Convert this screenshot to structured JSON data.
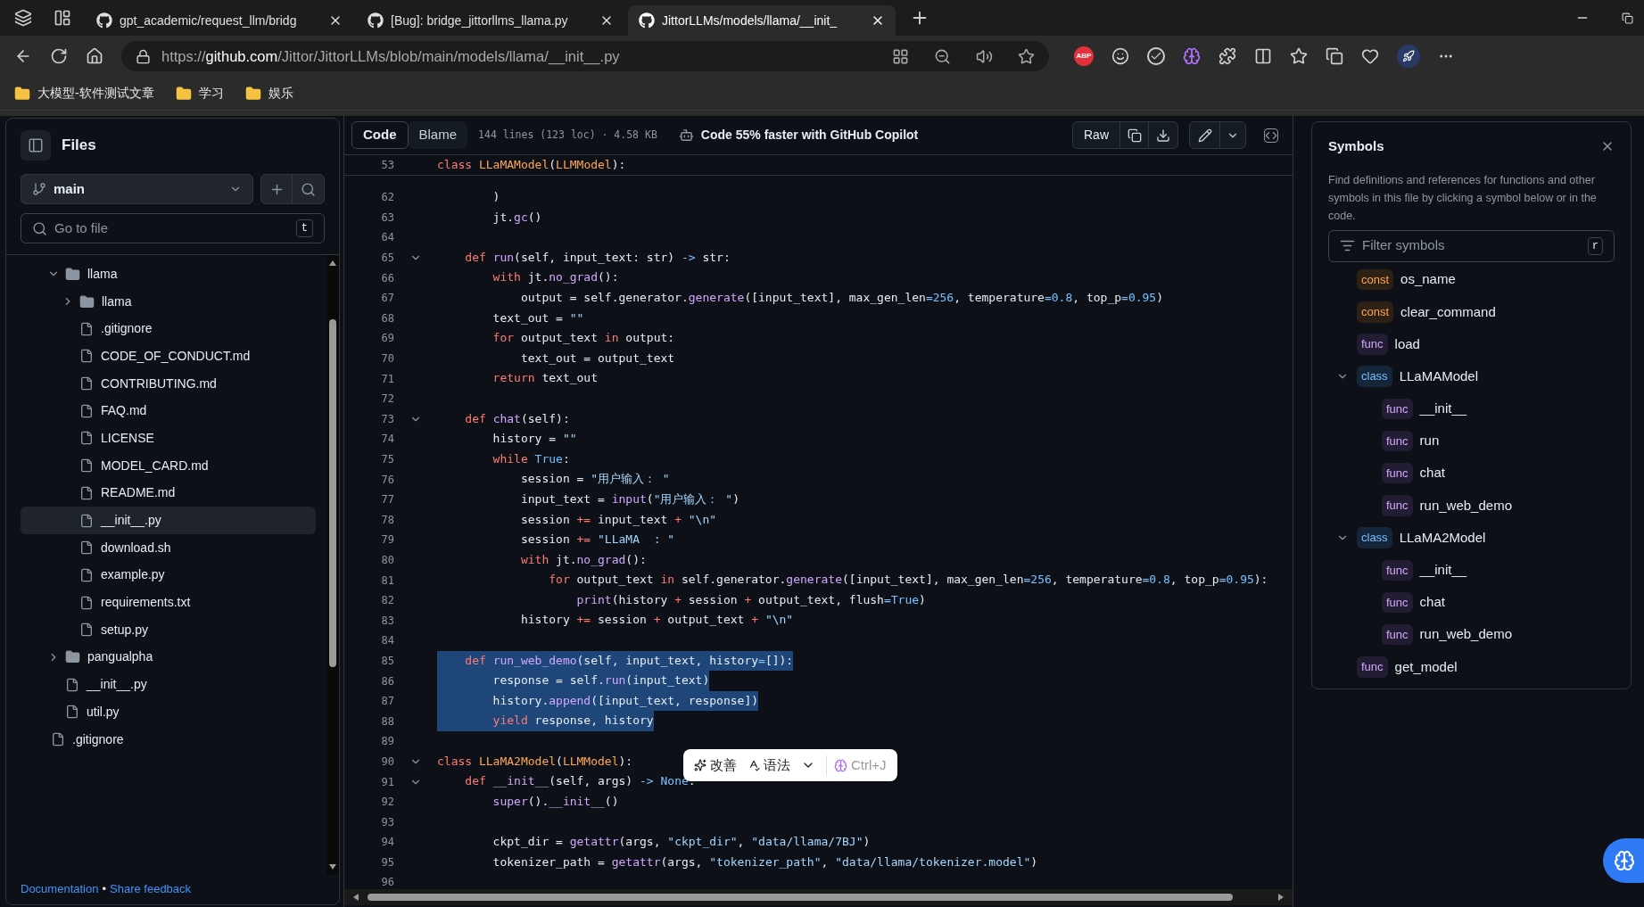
{
  "browser": {
    "tabs": [
      {
        "title": "gpt_academic/request_llm/bridg",
        "selected": false
      },
      {
        "title": "[Bug]: bridge_jittorllms_llama.py",
        "selected": false
      },
      {
        "title": "JittorLLMs/models/llama/__init_",
        "selected": true
      }
    ],
    "url": {
      "scheme": "https://",
      "host": "github.com",
      "path": "/Jittor/JittorLLMs/blob/main/models/llama/__init__.py"
    },
    "extension_badge": "ABP",
    "bookmarks": [
      "大模型-软件测试文章",
      "学习",
      "娱乐"
    ]
  },
  "files": {
    "title": "Files",
    "branch": "main",
    "search_placeholder": "Go to file",
    "search_key": "t",
    "tree": [
      {
        "kind": "hidden",
        "children": [
          {
            "kind": "folder",
            "name": "llama",
            "expanded": true,
            "selected": false,
            "children": [
              {
                "kind": "folder",
                "name": "llama",
                "expanded": false,
                "selected": false
              },
              {
                "kind": "file",
                "name": ".gitignore",
                "selected": false
              },
              {
                "kind": "file",
                "name": "CODE_OF_CONDUCT.md",
                "selected": false
              },
              {
                "kind": "file",
                "name": "CONTRIBUTING.md",
                "selected": false
              },
              {
                "kind": "file",
                "name": "FAQ.md",
                "selected": false
              },
              {
                "kind": "file",
                "name": "LICENSE",
                "selected": false
              },
              {
                "kind": "file",
                "name": "MODEL_CARD.md",
                "selected": false
              },
              {
                "kind": "file",
                "name": "README.md",
                "selected": false
              },
              {
                "kind": "file",
                "name": "__init__.py",
                "selected": true
              },
              {
                "kind": "file",
                "name": "download.sh",
                "selected": false
              },
              {
                "kind": "file",
                "name": "example.py",
                "selected": false
              },
              {
                "kind": "file",
                "name": "requirements.txt",
                "selected": false
              },
              {
                "kind": "file",
                "name": "setup.py",
                "selected": false
              }
            ]
          },
          {
            "kind": "folder",
            "name": "pangualpha",
            "expanded": false,
            "selected": false
          },
          {
            "kind": "file",
            "name": "__init__.py",
            "selected": false
          },
          {
            "kind": "file",
            "name": "util.py",
            "selected": false
          }
        ]
      },
      {
        "kind": "file",
        "name": ".gitignore",
        "selected": false
      }
    ],
    "footer": {
      "link1": "Documentation",
      "separator": "•",
      "link2": "Share feedback"
    }
  },
  "code": {
    "tabs": [
      {
        "label": "Code",
        "selected": true
      },
      {
        "label": "Blame",
        "selected": false
      }
    ],
    "info": "144 lines (123 loc) · 4.58 KB",
    "copilot": "Code 55% faster with GitHub Copilot",
    "raw": "Raw",
    "sticky": {
      "number": "53",
      "tokens": [
        {
          "kind": "k",
          "text": "class "
        },
        {
          "kind": "c",
          "text": "LLaMAModel"
        },
        {
          "kind": "p",
          "text": "("
        },
        {
          "kind": "c",
          "text": "LLMModel"
        },
        {
          "kind": "p",
          "text": "):"
        }
      ]
    },
    "lines": [
      {
        "number": "62",
        "fold": false,
        "selected": false,
        "tokens": [
          {
            "kind": "p",
            "text": "        )"
          }
        ]
      },
      {
        "number": "63",
        "fold": false,
        "selected": false,
        "tokens": [
          {
            "kind": "p",
            "text": "        jt."
          },
          {
            "kind": "f",
            "text": "gc"
          },
          {
            "kind": "p",
            "text": "()"
          }
        ]
      },
      {
        "number": "64",
        "fold": false,
        "selected": false
      },
      {
        "number": "65",
        "fold": true,
        "selected": false,
        "tokens": [
          {
            "kind": "k",
            "text": "    def "
          },
          {
            "kind": "f",
            "text": "run"
          },
          {
            "kind": "p",
            "text": "(self, input_text: str) "
          },
          {
            "kind": "n",
            "text": "->"
          },
          {
            "kind": "p",
            "text": " str:"
          }
        ]
      },
      {
        "number": "66",
        "fold": false,
        "selected": false,
        "tokens": [
          {
            "kind": "k",
            "text": "        with"
          },
          {
            "kind": "p",
            "text": " jt."
          },
          {
            "kind": "f",
            "text": "no_grad"
          },
          {
            "kind": "p",
            "text": "():"
          }
        ]
      },
      {
        "number": "67",
        "fold": false,
        "selected": false,
        "tokens": [
          {
            "kind": "p",
            "text": "            output = self.generator."
          },
          {
            "kind": "f",
            "text": "generate"
          },
          {
            "kind": "p",
            "text": "([input_text], max_gen_len"
          },
          {
            "kind": "n",
            "text": "=256"
          },
          {
            "kind": "p",
            "text": ", temperature"
          },
          {
            "kind": "n",
            "text": "=0.8"
          },
          {
            "kind": "p",
            "text": ", top_p"
          },
          {
            "kind": "n",
            "text": "=0.95"
          },
          {
            "kind": "p",
            "text": ")"
          }
        ]
      },
      {
        "number": "68",
        "fold": false,
        "selected": false,
        "tokens": [
          {
            "kind": "p",
            "text": "        text_out = "
          },
          {
            "kind": "s",
            "text": "\"\""
          }
        ]
      },
      {
        "number": "69",
        "fold": false,
        "selected": false,
        "tokens": [
          {
            "kind": "k",
            "text": "        for"
          },
          {
            "kind": "p",
            "text": " output_text "
          },
          {
            "kind": "k",
            "text": "in"
          },
          {
            "kind": "p",
            "text": " output:"
          }
        ]
      },
      {
        "number": "70",
        "fold": false,
        "selected": false,
        "tokens": [
          {
            "kind": "p",
            "text": "            text_out = output_text"
          }
        ]
      },
      {
        "number": "71",
        "fold": false,
        "selected": false,
        "tokens": [
          {
            "kind": "k",
            "text": "        return"
          },
          {
            "kind": "p",
            "text": " text_out"
          }
        ]
      },
      {
        "number": "72",
        "fold": false,
        "selected": false
      },
      {
        "number": "73",
        "fold": true,
        "selected": false,
        "tokens": [
          {
            "kind": "k",
            "text": "    def "
          },
          {
            "kind": "f",
            "text": "chat"
          },
          {
            "kind": "p",
            "text": "(self):"
          }
        ]
      },
      {
        "number": "74",
        "fold": false,
        "selected": false,
        "tokens": [
          {
            "kind": "p",
            "text": "        history = "
          },
          {
            "kind": "s",
            "text": "\"\""
          }
        ]
      },
      {
        "number": "75",
        "fold": false,
        "selected": false,
        "tokens": [
          {
            "kind": "k",
            "text": "        while"
          },
          {
            "kind": "n",
            "text": " True"
          },
          {
            "kind": "p",
            "text": ":"
          }
        ]
      },
      {
        "number": "76",
        "fold": false,
        "selected": false,
        "tokens": [
          {
            "kind": "p",
            "text": "            session = "
          },
          {
            "kind": "s",
            "text": "\"用户输入： \""
          }
        ]
      },
      {
        "number": "77",
        "fold": false,
        "selected": false,
        "tokens": [
          {
            "kind": "p",
            "text": "            input_text = "
          },
          {
            "kind": "f",
            "text": "input"
          },
          {
            "kind": "p",
            "text": "("
          },
          {
            "kind": "s",
            "text": "\"用户输入： \""
          },
          {
            "kind": "p",
            "text": ")"
          }
        ]
      },
      {
        "number": "78",
        "fold": false,
        "selected": false,
        "tokens": [
          {
            "kind": "p",
            "text": "            session "
          },
          {
            "kind": "k",
            "text": "+="
          },
          {
            "kind": "p",
            "text": " input_text "
          },
          {
            "kind": "k",
            "text": "+"
          },
          {
            "kind": "s",
            "text": " \"\\n\""
          }
        ]
      },
      {
        "number": "79",
        "fold": false,
        "selected": false,
        "tokens": [
          {
            "kind": "p",
            "text": "            session "
          },
          {
            "kind": "k",
            "text": "+="
          },
          {
            "kind": "s",
            "text": " \"LLaMA  : \""
          }
        ]
      },
      {
        "number": "80",
        "fold": false,
        "selected": false,
        "tokens": [
          {
            "kind": "k",
            "text": "            with"
          },
          {
            "kind": "p",
            "text": " jt."
          },
          {
            "kind": "f",
            "text": "no_grad"
          },
          {
            "kind": "p",
            "text": "():"
          }
        ]
      },
      {
        "number": "81",
        "fold": false,
        "selected": false,
        "tokens": [
          {
            "kind": "k",
            "text": "                for"
          },
          {
            "kind": "p",
            "text": " output_text "
          },
          {
            "kind": "k",
            "text": "in"
          },
          {
            "kind": "p",
            "text": " self.generator."
          },
          {
            "kind": "f",
            "text": "generate"
          },
          {
            "kind": "p",
            "text": "([input_text], max_gen_len"
          },
          {
            "kind": "n",
            "text": "=256"
          },
          {
            "kind": "p",
            "text": ", temperature"
          },
          {
            "kind": "n",
            "text": "=0.8"
          },
          {
            "kind": "p",
            "text": ", top_p"
          },
          {
            "kind": "n",
            "text": "=0.95"
          },
          {
            "kind": "p",
            "text": "):"
          }
        ]
      },
      {
        "number": "82",
        "fold": false,
        "selected": false,
        "tokens": [
          {
            "kind": "f",
            "text": "                    print"
          },
          {
            "kind": "p",
            "text": "(history "
          },
          {
            "kind": "k",
            "text": "+"
          },
          {
            "kind": "p",
            "text": " session "
          },
          {
            "kind": "k",
            "text": "+"
          },
          {
            "kind": "p",
            "text": " output_text, flush"
          },
          {
            "kind": "n",
            "text": "=True"
          },
          {
            "kind": "p",
            "text": ")"
          }
        ]
      },
      {
        "number": "83",
        "fold": false,
        "selected": false,
        "tokens": [
          {
            "kind": "p",
            "text": "            history "
          },
          {
            "kind": "k",
            "text": "+="
          },
          {
            "kind": "p",
            "text": " session "
          },
          {
            "kind": "k",
            "text": "+"
          },
          {
            "kind": "p",
            "text": " output_text "
          },
          {
            "kind": "k",
            "text": "+"
          },
          {
            "kind": "s",
            "text": " \"\\n\""
          }
        ]
      },
      {
        "number": "84",
        "fold": false,
        "selected": false
      },
      {
        "number": "85",
        "fold": false,
        "selected": true,
        "tokens": [
          {
            "kind": "k",
            "text": "    def "
          },
          {
            "kind": "f",
            "text": "run_web_demo"
          },
          {
            "kind": "p",
            "text": "(self, input_text, history"
          },
          {
            "kind": "n",
            "text": "="
          },
          {
            "kind": "p",
            "text": "[]):"
          }
        ]
      },
      {
        "number": "86",
        "fold": false,
        "selected": true,
        "tokens": [
          {
            "kind": "p",
            "text": "        response = self."
          },
          {
            "kind": "f",
            "text": "run"
          },
          {
            "kind": "p",
            "text": "(input_text)"
          }
        ]
      },
      {
        "number": "87",
        "fold": false,
        "selected": true,
        "tokens": [
          {
            "kind": "p",
            "text": "        history."
          },
          {
            "kind": "f",
            "text": "append"
          },
          {
            "kind": "p",
            "text": "([input_text, response])"
          }
        ]
      },
      {
        "number": "88",
        "fold": false,
        "selected": true,
        "tokens": [
          {
            "kind": "k",
            "text": "        yield"
          },
          {
            "kind": "p",
            "text": " response, history"
          }
        ]
      },
      {
        "number": "89",
        "fold": false,
        "selected": false
      },
      {
        "number": "90",
        "fold": true,
        "selected": false,
        "tokens": [
          {
            "kind": "k",
            "text": "class "
          },
          {
            "kind": "c",
            "text": "LLaMA2Model"
          },
          {
            "kind": "p",
            "text": "("
          },
          {
            "kind": "c",
            "text": "LLMModel"
          },
          {
            "kind": "p",
            "text": "):"
          }
        ]
      },
      {
        "number": "91",
        "fold": true,
        "selected": false,
        "tokens": [
          {
            "kind": "k",
            "text": "    def "
          },
          {
            "kind": "f",
            "text": "__init__"
          },
          {
            "kind": "p",
            "text": "(self, args) "
          },
          {
            "kind": "n",
            "text": "->"
          },
          {
            "kind": "n",
            "text": " None"
          },
          {
            "kind": "p",
            "text": ":"
          }
        ]
      },
      {
        "number": "92",
        "fold": false,
        "selected": false,
        "tokens": [
          {
            "kind": "f",
            "text": "        super"
          },
          {
            "kind": "p",
            "text": "()."
          },
          {
            "kind": "f",
            "text": "__init__"
          },
          {
            "kind": "p",
            "text": "()"
          }
        ]
      },
      {
        "number": "93",
        "fold": false,
        "selected": false
      },
      {
        "number": "94",
        "fold": false,
        "selected": false,
        "tokens": [
          {
            "kind": "p",
            "text": "        ckpt_dir = "
          },
          {
            "kind": "f",
            "text": "getattr"
          },
          {
            "kind": "p",
            "text": "(args, "
          },
          {
            "kind": "s",
            "text": "\"ckpt_dir\""
          },
          {
            "kind": "p",
            "text": ", "
          },
          {
            "kind": "s",
            "text": "\"data/llama/7BJ\""
          },
          {
            "kind": "p",
            "text": ")"
          }
        ]
      },
      {
        "number": "95",
        "fold": false,
        "selected": false,
        "tokens": [
          {
            "kind": "p",
            "text": "        tokenizer_path = "
          },
          {
            "kind": "f",
            "text": "getattr"
          },
          {
            "kind": "p",
            "text": "(args, "
          },
          {
            "kind": "s",
            "text": "\"tokenizer_path\""
          },
          {
            "kind": "p",
            "text": ", "
          },
          {
            "kind": "s",
            "text": "\"data/llama/tokenizer.model\""
          },
          {
            "kind": "p",
            "text": ")"
          }
        ]
      },
      {
        "number": "96",
        "fold": false,
        "selected": false
      }
    ]
  },
  "popup": {
    "improve": "改善",
    "grammar": "语法",
    "shortcut": "Ctrl+J"
  },
  "symbols": {
    "title": "Symbols",
    "description": "Find definitions and references for functions and other symbols in this file by clicking a symbol below or in the code.",
    "filter_placeholder": "Filter symbols",
    "filter_key": "r",
    "items": [
      {
        "kind": "const",
        "name": "os_name"
      },
      {
        "kind": "const",
        "name": "clear_command"
      },
      {
        "kind": "func",
        "name": "load"
      },
      {
        "kind": "class",
        "name": "LLaMAModel",
        "expanded": true,
        "children": [
          {
            "kind": "func",
            "name": "__init__"
          },
          {
            "kind": "func",
            "name": "run"
          },
          {
            "kind": "func",
            "name": "chat"
          },
          {
            "kind": "func",
            "name": "run_web_demo"
          }
        ]
      },
      {
        "kind": "class",
        "name": "LLaMA2Model",
        "expanded": true,
        "children": [
          {
            "kind": "func",
            "name": "__init__"
          },
          {
            "kind": "func",
            "name": "chat"
          },
          {
            "kind": "func",
            "name": "run_web_demo"
          }
        ]
      },
      {
        "kind": "func",
        "name": "get_model"
      }
    ]
  }
}
